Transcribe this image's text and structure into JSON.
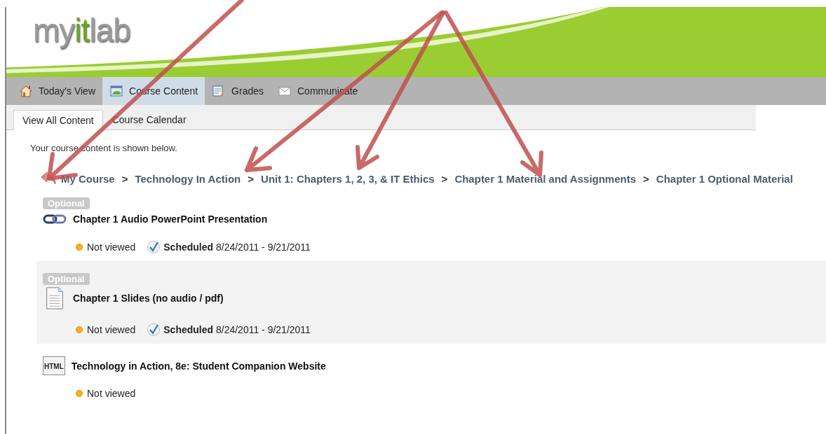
{
  "logo": [
    {
      "text": "my",
      "accent": false
    },
    {
      "text": "it",
      "accent": true
    },
    {
      "text": "lab",
      "accent": false
    }
  ],
  "nav": [
    {
      "label": "Today's View",
      "selected": false
    },
    {
      "label": "Course Content",
      "selected": true
    },
    {
      "label": "Grades",
      "selected": false
    },
    {
      "label": "Communicate",
      "selected": false
    }
  ],
  "subtabs": [
    {
      "label": "View All Content",
      "selected": true
    },
    {
      "label": "Course Calendar",
      "selected": false
    }
  ],
  "intro": "Your course content is shown below.",
  "breadcrumb": {
    "separator": ">",
    "items": [
      "My Course",
      "Technology In Action",
      "Unit 1: Chapters 1, 2, 3, & IT Ethics",
      "Chapter 1 Material and Assignments",
      "Chapter 1 Optional Material"
    ]
  },
  "items": [
    {
      "kind": "link",
      "optional": true,
      "badge": "Optional",
      "title": "Chapter 1 Audio PowerPoint Presentation",
      "status": "Not viewed",
      "schedule": {
        "label": "Scheduled",
        "dates": "8/24/2011 - 9/21/2011"
      }
    },
    {
      "kind": "document",
      "optional": true,
      "badge": "Optional",
      "title": "Chapter 1 Slides (no audio / pdf)",
      "status": "Not viewed",
      "schedule": {
        "label": "Scheduled",
        "dates": "8/24/2011 - 9/21/2011"
      }
    },
    {
      "kind": "html",
      "icon_label": "HTML",
      "title": "Technology in Action, 8e: Student Companion Website",
      "status": "Not viewed"
    }
  ]
}
